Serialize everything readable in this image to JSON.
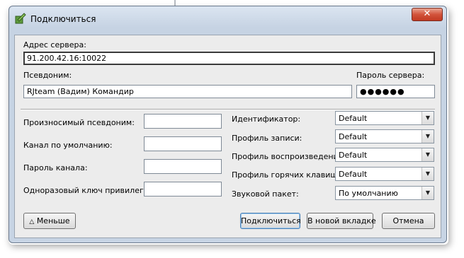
{
  "window": {
    "title": "Подключиться",
    "close_glyph": "✕"
  },
  "server": {
    "address_label": "Адрес сервера:",
    "address_value": "91.200.42.16:10022",
    "nickname_label": "Псевдоним:",
    "nickname_value": "RJteam (Вадим) Командир",
    "password_label": "Пароль сервера:",
    "password_value": "●●●●●●"
  },
  "left_fields": [
    {
      "label": "Произносимый псевдоним:",
      "value": ""
    },
    {
      "label": "Канал по умолчанию:",
      "value": ""
    },
    {
      "label": "Пароль канала:",
      "value": ""
    },
    {
      "label": "Одноразовый ключ привилегий:",
      "value": ""
    }
  ],
  "right_fields": [
    {
      "label": "Идентификатор:",
      "value": "Default"
    },
    {
      "label": "Профиль записи:",
      "value": "Default"
    },
    {
      "label": "Профиль воспроизведения:",
      "value": "Default"
    },
    {
      "label": "Профиль горячих клавиш:",
      "value": "Default"
    },
    {
      "label": "Звуковой пакет:",
      "value": "По умолчанию"
    }
  ],
  "buttons": {
    "less": "Меньше",
    "less_icon": "△",
    "connect": "Подключиться",
    "new_tab": "В новой вкладке",
    "cancel": "Отмена"
  },
  "icons": {
    "app": "teamspeak-connect-icon",
    "dropdown": "▼"
  },
  "colors": {
    "titlebar": "#c6d3e3",
    "close_button": "#d2533b",
    "client_area": "#ececec"
  }
}
